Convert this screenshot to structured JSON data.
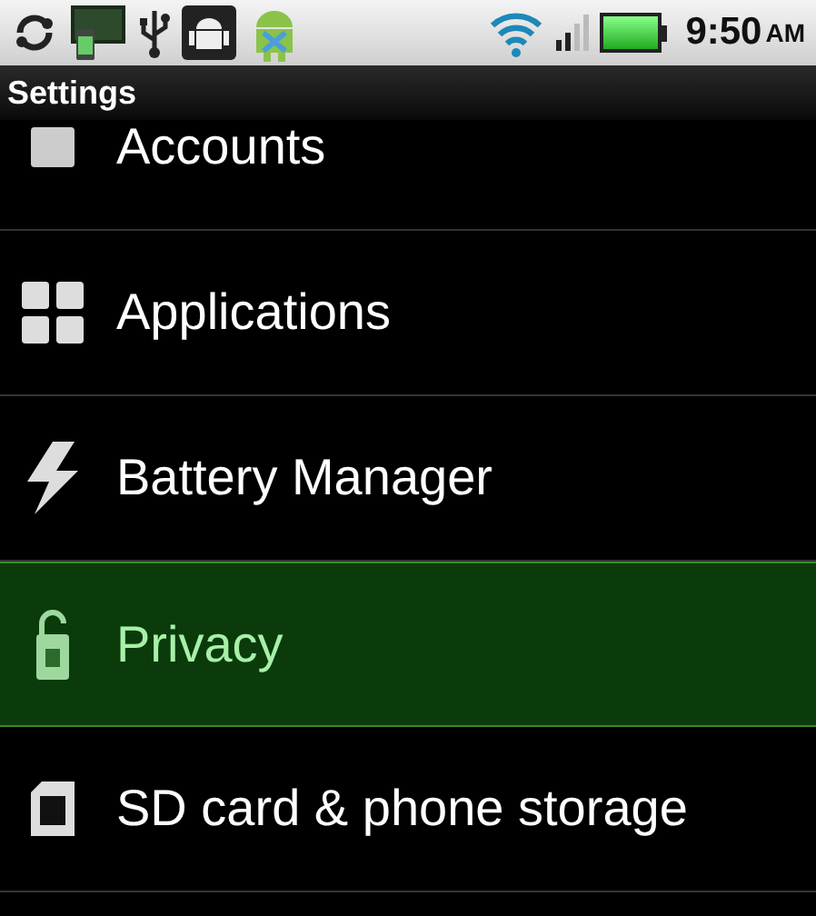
{
  "status_bar": {
    "time": "9:50",
    "meridiem": "AM",
    "battery": {
      "level": 1.0
    }
  },
  "title_bar": {
    "title": "Settings"
  },
  "settings": [
    {
      "label": "Accounts",
      "kind": "accounts",
      "selected": false
    },
    {
      "label": "Applications",
      "kind": "applications",
      "selected": false
    },
    {
      "label": "Battery Manager",
      "kind": "battery",
      "selected": false
    },
    {
      "label": "Privacy",
      "kind": "privacy",
      "selected": true
    },
    {
      "label": "SD card & phone storage",
      "kind": "storage",
      "selected": false
    }
  ]
}
